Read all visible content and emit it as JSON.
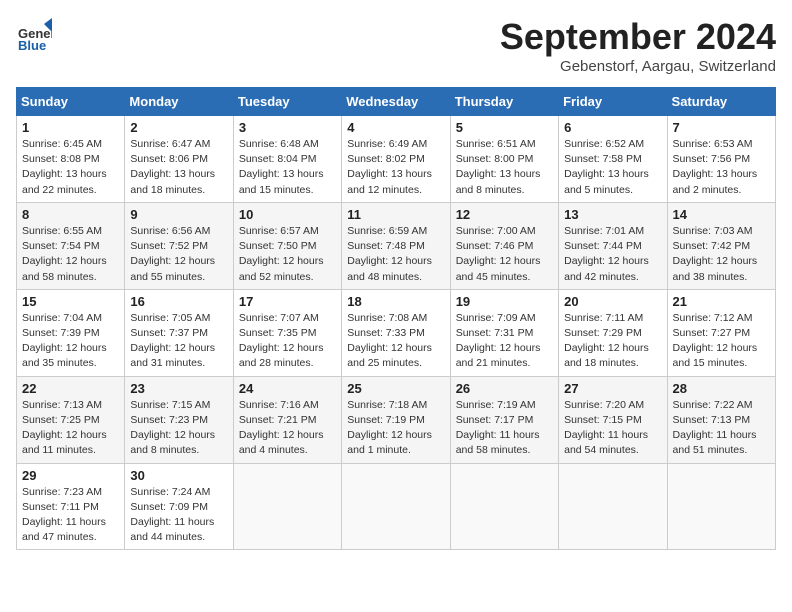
{
  "header": {
    "logo": {
      "general": "General",
      "blue": "Blue"
    },
    "title": "September 2024",
    "location": "Gebenstorf, Aargau, Switzerland"
  },
  "weekdays": [
    "Sunday",
    "Monday",
    "Tuesday",
    "Wednesday",
    "Thursday",
    "Friday",
    "Saturday"
  ],
  "weeks": [
    [
      {
        "day": "1",
        "sunrise": "6:45 AM",
        "sunset": "8:08 PM",
        "daylight": "13 hours and 22 minutes."
      },
      {
        "day": "2",
        "sunrise": "6:47 AM",
        "sunset": "8:06 PM",
        "daylight": "13 hours and 18 minutes."
      },
      {
        "day": "3",
        "sunrise": "6:48 AM",
        "sunset": "8:04 PM",
        "daylight": "13 hours and 15 minutes."
      },
      {
        "day": "4",
        "sunrise": "6:49 AM",
        "sunset": "8:02 PM",
        "daylight": "13 hours and 12 minutes."
      },
      {
        "day": "5",
        "sunrise": "6:51 AM",
        "sunset": "8:00 PM",
        "daylight": "13 hours and 8 minutes."
      },
      {
        "day": "6",
        "sunrise": "6:52 AM",
        "sunset": "7:58 PM",
        "daylight": "13 hours and 5 minutes."
      },
      {
        "day": "7",
        "sunrise": "6:53 AM",
        "sunset": "7:56 PM",
        "daylight": "13 hours and 2 minutes."
      }
    ],
    [
      {
        "day": "8",
        "sunrise": "6:55 AM",
        "sunset": "7:54 PM",
        "daylight": "12 hours and 58 minutes."
      },
      {
        "day": "9",
        "sunrise": "6:56 AM",
        "sunset": "7:52 PM",
        "daylight": "12 hours and 55 minutes."
      },
      {
        "day": "10",
        "sunrise": "6:57 AM",
        "sunset": "7:50 PM",
        "daylight": "12 hours and 52 minutes."
      },
      {
        "day": "11",
        "sunrise": "6:59 AM",
        "sunset": "7:48 PM",
        "daylight": "12 hours and 48 minutes."
      },
      {
        "day": "12",
        "sunrise": "7:00 AM",
        "sunset": "7:46 PM",
        "daylight": "12 hours and 45 minutes."
      },
      {
        "day": "13",
        "sunrise": "7:01 AM",
        "sunset": "7:44 PM",
        "daylight": "12 hours and 42 minutes."
      },
      {
        "day": "14",
        "sunrise": "7:03 AM",
        "sunset": "7:42 PM",
        "daylight": "12 hours and 38 minutes."
      }
    ],
    [
      {
        "day": "15",
        "sunrise": "7:04 AM",
        "sunset": "7:39 PM",
        "daylight": "12 hours and 35 minutes."
      },
      {
        "day": "16",
        "sunrise": "7:05 AM",
        "sunset": "7:37 PM",
        "daylight": "12 hours and 31 minutes."
      },
      {
        "day": "17",
        "sunrise": "7:07 AM",
        "sunset": "7:35 PM",
        "daylight": "12 hours and 28 minutes."
      },
      {
        "day": "18",
        "sunrise": "7:08 AM",
        "sunset": "7:33 PM",
        "daylight": "12 hours and 25 minutes."
      },
      {
        "day": "19",
        "sunrise": "7:09 AM",
        "sunset": "7:31 PM",
        "daylight": "12 hours and 21 minutes."
      },
      {
        "day": "20",
        "sunrise": "7:11 AM",
        "sunset": "7:29 PM",
        "daylight": "12 hours and 18 minutes."
      },
      {
        "day": "21",
        "sunrise": "7:12 AM",
        "sunset": "7:27 PM",
        "daylight": "12 hours and 15 minutes."
      }
    ],
    [
      {
        "day": "22",
        "sunrise": "7:13 AM",
        "sunset": "7:25 PM",
        "daylight": "12 hours and 11 minutes."
      },
      {
        "day": "23",
        "sunrise": "7:15 AM",
        "sunset": "7:23 PM",
        "daylight": "12 hours and 8 minutes."
      },
      {
        "day": "24",
        "sunrise": "7:16 AM",
        "sunset": "7:21 PM",
        "daylight": "12 hours and 4 minutes."
      },
      {
        "day": "25",
        "sunrise": "7:18 AM",
        "sunset": "7:19 PM",
        "daylight": "12 hours and 1 minute."
      },
      {
        "day": "26",
        "sunrise": "7:19 AM",
        "sunset": "7:17 PM",
        "daylight": "11 hours and 58 minutes."
      },
      {
        "day": "27",
        "sunrise": "7:20 AM",
        "sunset": "7:15 PM",
        "daylight": "11 hours and 54 minutes."
      },
      {
        "day": "28",
        "sunrise": "7:22 AM",
        "sunset": "7:13 PM",
        "daylight": "11 hours and 51 minutes."
      }
    ],
    [
      {
        "day": "29",
        "sunrise": "7:23 AM",
        "sunset": "7:11 PM",
        "daylight": "11 hours and 47 minutes."
      },
      {
        "day": "30",
        "sunrise": "7:24 AM",
        "sunset": "7:09 PM",
        "daylight": "11 hours and 44 minutes."
      },
      null,
      null,
      null,
      null,
      null
    ]
  ]
}
